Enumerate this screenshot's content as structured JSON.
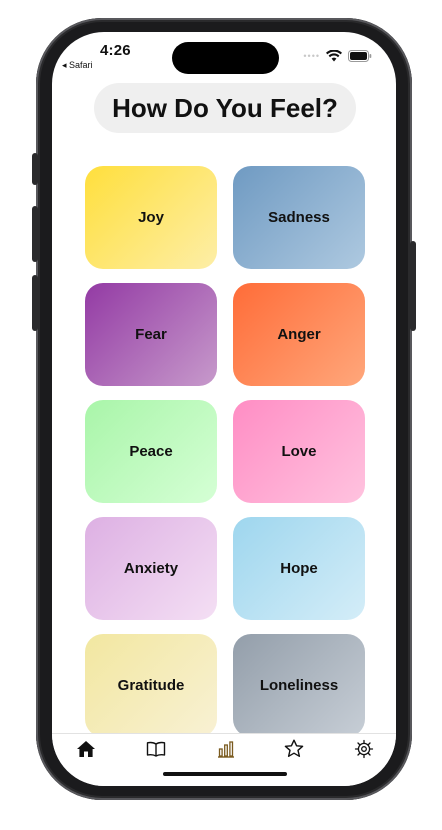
{
  "status_bar": {
    "time": "4:26",
    "back_label": "◂ Safari",
    "signal": "••••"
  },
  "header": {
    "title": "How Do You Feel?"
  },
  "emotions": [
    {
      "label": "Joy"
    },
    {
      "label": "Sadness"
    },
    {
      "label": "Fear"
    },
    {
      "label": "Anger"
    },
    {
      "label": "Peace"
    },
    {
      "label": "Love"
    },
    {
      "label": "Anxiety"
    },
    {
      "label": "Hope"
    },
    {
      "label": "Gratitude"
    },
    {
      "label": "Loneliness"
    }
  ],
  "tab_bar": {
    "items": [
      {
        "icon": "home-icon",
        "selected": true
      },
      {
        "icon": "book-icon",
        "selected": false
      },
      {
        "icon": "bar-chart-icon",
        "selected": false
      },
      {
        "icon": "star-icon",
        "selected": false
      },
      {
        "icon": "gear-icon",
        "selected": false
      }
    ]
  }
}
